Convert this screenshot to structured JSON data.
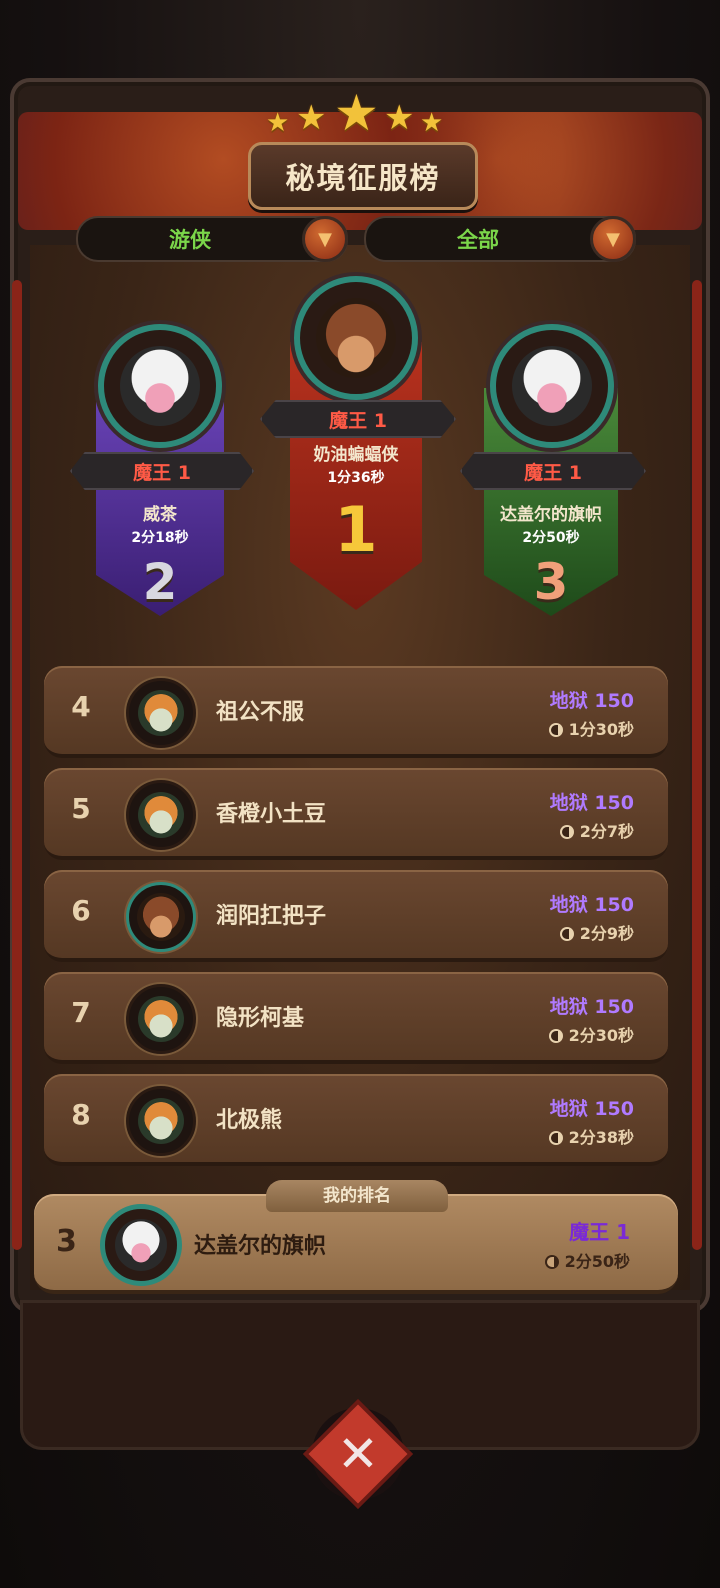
{
  "title": "秘境征服榜",
  "filters": {
    "class": "游侠",
    "scope": "全部"
  },
  "podium": [
    {
      "place": "2",
      "rank_label": "魔王 1",
      "name": "威茶",
      "time": "2分18秒",
      "avatar": "cow-avatar",
      "color": "#4a2a8a"
    },
    {
      "place": "1",
      "rank_label": "魔王 1",
      "name": "奶油蝙蝠侠",
      "time": "1分36秒",
      "avatar": "bear-avatar",
      "color": "#9a2a18"
    },
    {
      "place": "3",
      "rank_label": "魔王 1",
      "name": "达盖尔的旗帜",
      "time": "2分50秒",
      "avatar": "cow-avatar",
      "color": "#2a5a2a"
    }
  ],
  "rows": [
    {
      "rank": "4",
      "name": "祖公不服",
      "level": "地狱 150",
      "time": "1分30秒",
      "avatar": "fox-avatar"
    },
    {
      "rank": "5",
      "name": "香橙小土豆",
      "level": "地狱 150",
      "time": "2分7秒",
      "avatar": "fox-avatar"
    },
    {
      "rank": "6",
      "name": "润阳扛把子",
      "level": "地狱 150",
      "time": "2分9秒",
      "avatar": "bear-avatar"
    },
    {
      "rank": "7",
      "name": "隐形柯基",
      "level": "地狱 150",
      "time": "2分30秒",
      "avatar": "fox-avatar"
    },
    {
      "rank": "8",
      "name": "北极熊",
      "level": "地狱 150",
      "time": "2分38秒",
      "avatar": "fox-avatar"
    }
  ],
  "my_rank": {
    "tab_label": "我的排名",
    "rank": "3",
    "name": "达盖尔的旗帜",
    "level": "魔王 1",
    "time": "2分50秒",
    "avatar": "cow-avatar"
  },
  "close_icon": "close-icon"
}
